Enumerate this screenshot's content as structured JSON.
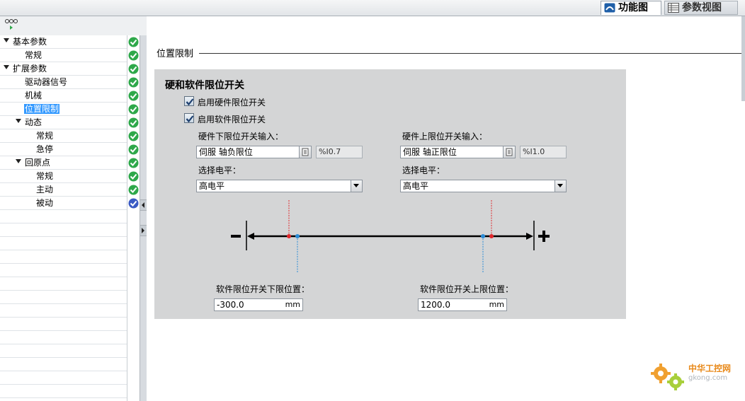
{
  "tabs": {
    "function_view": "功能图",
    "parameter_view": "参数视图"
  },
  "tree": [
    {
      "label": "基本参数",
      "expanded": true,
      "status": "ok"
    },
    {
      "label": "常规",
      "status": "ok"
    },
    {
      "label": "扩展参数",
      "expanded": true,
      "status": "ok"
    },
    {
      "label": "驱动器信号",
      "status": "ok"
    },
    {
      "label": "机械",
      "status": "ok"
    },
    {
      "label": "位置限制",
      "selected": true,
      "status": "ok"
    },
    {
      "label": "动态",
      "expanded": true,
      "status": "ok"
    },
    {
      "label": "常规",
      "status": "ok"
    },
    {
      "label": "急停",
      "status": "ok"
    },
    {
      "label": "回原点",
      "expanded": true,
      "status": "ok"
    },
    {
      "label": "常规",
      "status": "ok"
    },
    {
      "label": "主动",
      "status": "ok"
    },
    {
      "label": "被动",
      "status": "partial"
    }
  ],
  "section": {
    "title": "位置限制"
  },
  "panel": {
    "title": "硬和软件限位开关",
    "enable_hw_label": "启用硬件限位开关",
    "enable_hw_checked": true,
    "enable_sw_label": "启用软件限位开关",
    "enable_sw_checked": true,
    "hw_low_input_label": "硬件下限位开关输入：",
    "hw_low_input_value": "伺服 轴负限位",
    "hw_low_address": "%I0.7",
    "hw_high_input_label": "硬件上限位开关输入：",
    "hw_high_input_value": "伺服 轴正限位",
    "hw_high_address": "%I1.0",
    "level_label": "选择电平：",
    "hw_low_level": "高电平",
    "hw_high_level": "高电平",
    "sw_low_label": "软件限位开关下限位置：",
    "sw_low_value": "-300.0",
    "sw_high_label": "软件限位开关上限位置：",
    "sw_high_value": "1200.0",
    "unit": "mm"
  },
  "colors": {
    "ok": "#2ea84a",
    "partial": "#3b5bc4",
    "hw_limit": "#e0262a",
    "sw_limit": "#2a8bd6",
    "selected": "#3399ff"
  },
  "watermark": {
    "line1": "中华工控网",
    "line2": "gkong.com"
  }
}
